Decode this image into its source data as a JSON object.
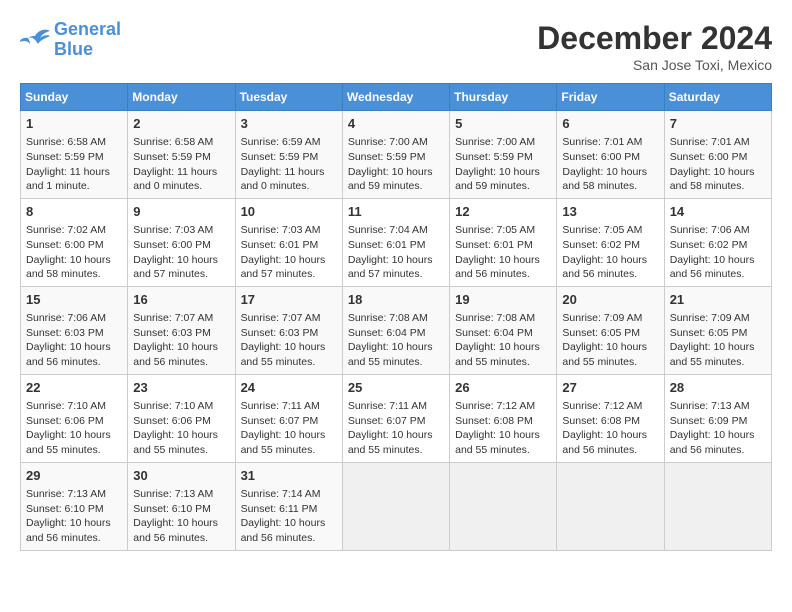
{
  "header": {
    "logo_line1": "General",
    "logo_line2": "Blue",
    "month_title": "December 2024",
    "location": "San Jose Toxi, Mexico"
  },
  "days_of_week": [
    "Sunday",
    "Monday",
    "Tuesday",
    "Wednesday",
    "Thursday",
    "Friday",
    "Saturday"
  ],
  "weeks": [
    [
      {
        "day": "1",
        "sunrise": "6:58 AM",
        "sunset": "5:59 PM",
        "daylight": "11 hours and 1 minute."
      },
      {
        "day": "2",
        "sunrise": "6:58 AM",
        "sunset": "5:59 PM",
        "daylight": "11 hours and 0 minutes."
      },
      {
        "day": "3",
        "sunrise": "6:59 AM",
        "sunset": "5:59 PM",
        "daylight": "11 hours and 0 minutes."
      },
      {
        "day": "4",
        "sunrise": "7:00 AM",
        "sunset": "5:59 PM",
        "daylight": "10 hours and 59 minutes."
      },
      {
        "day": "5",
        "sunrise": "7:00 AM",
        "sunset": "5:59 PM",
        "daylight": "10 hours and 59 minutes."
      },
      {
        "day": "6",
        "sunrise": "7:01 AM",
        "sunset": "6:00 PM",
        "daylight": "10 hours and 58 minutes."
      },
      {
        "day": "7",
        "sunrise": "7:01 AM",
        "sunset": "6:00 PM",
        "daylight": "10 hours and 58 minutes."
      }
    ],
    [
      {
        "day": "8",
        "sunrise": "7:02 AM",
        "sunset": "6:00 PM",
        "daylight": "10 hours and 58 minutes."
      },
      {
        "day": "9",
        "sunrise": "7:03 AM",
        "sunset": "6:00 PM",
        "daylight": "10 hours and 57 minutes."
      },
      {
        "day": "10",
        "sunrise": "7:03 AM",
        "sunset": "6:01 PM",
        "daylight": "10 hours and 57 minutes."
      },
      {
        "day": "11",
        "sunrise": "7:04 AM",
        "sunset": "6:01 PM",
        "daylight": "10 hours and 57 minutes."
      },
      {
        "day": "12",
        "sunrise": "7:05 AM",
        "sunset": "6:01 PM",
        "daylight": "10 hours and 56 minutes."
      },
      {
        "day": "13",
        "sunrise": "7:05 AM",
        "sunset": "6:02 PM",
        "daylight": "10 hours and 56 minutes."
      },
      {
        "day": "14",
        "sunrise": "7:06 AM",
        "sunset": "6:02 PM",
        "daylight": "10 hours and 56 minutes."
      }
    ],
    [
      {
        "day": "15",
        "sunrise": "7:06 AM",
        "sunset": "6:03 PM",
        "daylight": "10 hours and 56 minutes."
      },
      {
        "day": "16",
        "sunrise": "7:07 AM",
        "sunset": "6:03 PM",
        "daylight": "10 hours and 56 minutes."
      },
      {
        "day": "17",
        "sunrise": "7:07 AM",
        "sunset": "6:03 PM",
        "daylight": "10 hours and 55 minutes."
      },
      {
        "day": "18",
        "sunrise": "7:08 AM",
        "sunset": "6:04 PM",
        "daylight": "10 hours and 55 minutes."
      },
      {
        "day": "19",
        "sunrise": "7:08 AM",
        "sunset": "6:04 PM",
        "daylight": "10 hours and 55 minutes."
      },
      {
        "day": "20",
        "sunrise": "7:09 AM",
        "sunset": "6:05 PM",
        "daylight": "10 hours and 55 minutes."
      },
      {
        "day": "21",
        "sunrise": "7:09 AM",
        "sunset": "6:05 PM",
        "daylight": "10 hours and 55 minutes."
      }
    ],
    [
      {
        "day": "22",
        "sunrise": "7:10 AM",
        "sunset": "6:06 PM",
        "daylight": "10 hours and 55 minutes."
      },
      {
        "day": "23",
        "sunrise": "7:10 AM",
        "sunset": "6:06 PM",
        "daylight": "10 hours and 55 minutes."
      },
      {
        "day": "24",
        "sunrise": "7:11 AM",
        "sunset": "6:07 PM",
        "daylight": "10 hours and 55 minutes."
      },
      {
        "day": "25",
        "sunrise": "7:11 AM",
        "sunset": "6:07 PM",
        "daylight": "10 hours and 55 minutes."
      },
      {
        "day": "26",
        "sunrise": "7:12 AM",
        "sunset": "6:08 PM",
        "daylight": "10 hours and 55 minutes."
      },
      {
        "day": "27",
        "sunrise": "7:12 AM",
        "sunset": "6:08 PM",
        "daylight": "10 hours and 56 minutes."
      },
      {
        "day": "28",
        "sunrise": "7:13 AM",
        "sunset": "6:09 PM",
        "daylight": "10 hours and 56 minutes."
      }
    ],
    [
      {
        "day": "29",
        "sunrise": "7:13 AM",
        "sunset": "6:10 PM",
        "daylight": "10 hours and 56 minutes."
      },
      {
        "day": "30",
        "sunrise": "7:13 AM",
        "sunset": "6:10 PM",
        "daylight": "10 hours and 56 minutes."
      },
      {
        "day": "31",
        "sunrise": "7:14 AM",
        "sunset": "6:11 PM",
        "daylight": "10 hours and 56 minutes."
      },
      {
        "day": "",
        "sunrise": "",
        "sunset": "",
        "daylight": ""
      },
      {
        "day": "",
        "sunrise": "",
        "sunset": "",
        "daylight": ""
      },
      {
        "day": "",
        "sunrise": "",
        "sunset": "",
        "daylight": ""
      },
      {
        "day": "",
        "sunrise": "",
        "sunset": "",
        "daylight": ""
      }
    ]
  ],
  "labels": {
    "sunrise_prefix": "Sunrise: ",
    "sunset_prefix": "Sunset: ",
    "daylight_prefix": "Daylight: "
  }
}
